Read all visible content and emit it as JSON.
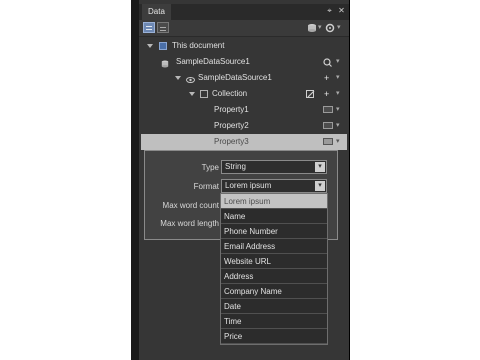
{
  "panel": {
    "tab_title": "Data",
    "header_icons": [
      "pin-icon",
      "close-icon"
    ]
  },
  "tree": {
    "root": {
      "label": "This document"
    },
    "datasource": {
      "label": "SampleDataSource1"
    },
    "datasource_child": {
      "label": "SampleDataSource1",
      "add_label": "+"
    },
    "collection": {
      "label": "Collection",
      "add_label": "+"
    },
    "properties": [
      {
        "label": "Property1"
      },
      {
        "label": "Property2"
      },
      {
        "label": "Property3"
      }
    ]
  },
  "property_editor": {
    "type_label": "Type",
    "type_value": "String",
    "format_label": "Format",
    "format_value": "Lorem ipsum",
    "max_word_count_label": "Max word count",
    "max_word_length_label": "Max word length"
  },
  "format_options": [
    "Lorem ipsum",
    "Name",
    "Phone Number",
    "Email Address",
    "Website URL",
    "Address",
    "Company Name",
    "Date",
    "Time",
    "Price"
  ],
  "format_selected_index": 0,
  "colors": {
    "panel_bg": "#363636",
    "selection_bg": "#bfbfbf",
    "accent_blue": "#6d88b3"
  }
}
